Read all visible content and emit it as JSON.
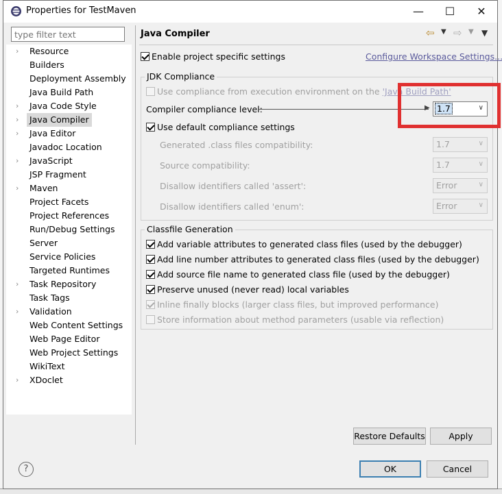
{
  "window": {
    "title": "Properties for TestMaven",
    "minimize_glyph": "—",
    "maximize_glyph": "☐",
    "close_glyph": "✕"
  },
  "filter": {
    "placeholder": "type filter text"
  },
  "tree": {
    "items": [
      {
        "label": "Resource",
        "expandable": true
      },
      {
        "label": "Builders",
        "expandable": false
      },
      {
        "label": "Deployment Assembly",
        "expandable": false
      },
      {
        "label": "Java Build Path",
        "expandable": false
      },
      {
        "label": "Java Code Style",
        "expandable": true
      },
      {
        "label": "Java Compiler",
        "expandable": true,
        "selected": true
      },
      {
        "label": "Java Editor",
        "expandable": true
      },
      {
        "label": "Javadoc Location",
        "expandable": false
      },
      {
        "label": "JavaScript",
        "expandable": true
      },
      {
        "label": "JSP Fragment",
        "expandable": false
      },
      {
        "label": "Maven",
        "expandable": true
      },
      {
        "label": "Project Facets",
        "expandable": false
      },
      {
        "label": "Project References",
        "expandable": false
      },
      {
        "label": "Run/Debug Settings",
        "expandable": false
      },
      {
        "label": "Server",
        "expandable": false
      },
      {
        "label": "Service Policies",
        "expandable": false
      },
      {
        "label": "Targeted Runtimes",
        "expandable": false
      },
      {
        "label": "Task Repository",
        "expandable": true
      },
      {
        "label": "Task Tags",
        "expandable": false
      },
      {
        "label": "Validation",
        "expandable": true
      },
      {
        "label": "Web Content Settings",
        "expandable": false
      },
      {
        "label": "Web Page Editor",
        "expandable": false
      },
      {
        "label": "Web Project Settings",
        "expandable": false
      },
      {
        "label": "WikiText",
        "expandable": false
      },
      {
        "label": "XDoclet",
        "expandable": true
      }
    ]
  },
  "page": {
    "title": "Java Compiler",
    "nav_back_icon": "back-arrow-icon",
    "nav_forward_icon": "forward-arrow-icon"
  },
  "settings": {
    "enable_project_specific": "Enable project specific settings",
    "enable_project_specific_checked": true,
    "configure_workspace_link": "Configure Workspace Settings..."
  },
  "jdk": {
    "group_title": "JDK Compliance",
    "use_env_prefix": "Use compliance from execution environment on the ",
    "use_env_link": "'Java Build Path'",
    "use_env_checked": false,
    "compliance_label": "Compiler compliance level:",
    "compliance_value": "1.7",
    "use_default": "Use default compliance settings",
    "use_default_checked": true,
    "class_compat_label": "Generated .class files compatibility:",
    "class_compat_value": "1.7",
    "source_compat_label": "Source compatibility:",
    "source_compat_value": "1.7",
    "assert_label": "Disallow identifiers called 'assert':",
    "assert_value": "Error",
    "enum_label": "Disallow identifiers called 'enum':",
    "enum_value": "Error"
  },
  "classfile": {
    "group_title": "Classfile Generation",
    "options": [
      {
        "label": "Add variable attributes to generated class files (used by the debugger)",
        "checked": true,
        "enabled": true
      },
      {
        "label": "Add line number attributes to generated class files (used by the debugger)",
        "checked": true,
        "enabled": true
      },
      {
        "label": "Add source file name to generated class file (used by the debugger)",
        "checked": true,
        "enabled": true
      },
      {
        "label": "Preserve unused (never read) local variables",
        "checked": true,
        "enabled": true
      },
      {
        "label": "Inline finally blocks (larger class files, but improved performance)",
        "checked": true,
        "enabled": false
      },
      {
        "label": "Store information about method parameters (usable via reflection)",
        "checked": false,
        "enabled": false
      }
    ]
  },
  "buttons": {
    "restore_defaults": "Restore Defaults",
    "apply": "Apply",
    "ok": "OK",
    "cancel": "Cancel",
    "help": "?"
  },
  "colors": {
    "highlight": "#e03030",
    "default_button_border": "#3c7fb1"
  }
}
